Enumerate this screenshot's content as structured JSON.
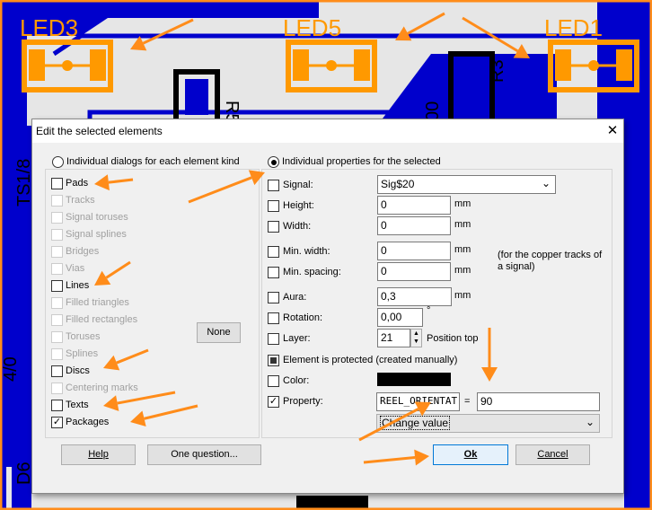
{
  "pcb": {
    "labels": [
      "LED3",
      "LED5",
      "LED1",
      "R5",
      "R3",
      "00",
      "TS1/8",
      "4/0",
      "D6"
    ]
  },
  "dialog": {
    "title": "Edit the selected elements",
    "close_label": "✕",
    "mode_left": "Individual dialogs for each element kind",
    "mode_right": "Individual properties for the selected",
    "mode_selected": "right",
    "element_kinds": [
      {
        "label": "Pads",
        "enabled": true,
        "checked": false
      },
      {
        "label": "Tracks",
        "enabled": false,
        "checked": false
      },
      {
        "label": "Signal toruses",
        "enabled": false,
        "checked": false
      },
      {
        "label": "Signal splines",
        "enabled": false,
        "checked": false
      },
      {
        "label": "Bridges",
        "enabled": false,
        "checked": false
      },
      {
        "label": "Vias",
        "enabled": false,
        "checked": false
      },
      {
        "label": "Lines",
        "enabled": true,
        "checked": false
      },
      {
        "label": "Filled triangles",
        "enabled": false,
        "checked": false
      },
      {
        "label": "Filled rectangles",
        "enabled": false,
        "checked": false
      },
      {
        "label": "Toruses",
        "enabled": false,
        "checked": false
      },
      {
        "label": "Splines",
        "enabled": false,
        "checked": false
      },
      {
        "label": "Discs",
        "enabled": true,
        "checked": false
      },
      {
        "label": "Centering marks",
        "enabled": false,
        "checked": false
      },
      {
        "label": "Texts",
        "enabled": true,
        "checked": false
      },
      {
        "label": "Packages",
        "enabled": true,
        "checked": true
      }
    ],
    "none_button": "None",
    "props": {
      "signal": {
        "label": "Signal:",
        "value": "Sig$20"
      },
      "height": {
        "label": "Height:",
        "value": "0",
        "unit": "mm"
      },
      "width": {
        "label": "Width:",
        "value": "0",
        "unit": "mm"
      },
      "min_width": {
        "label": "Min. width:",
        "value": "0",
        "unit": "mm"
      },
      "min_spacing": {
        "label": "Min. spacing:",
        "value": "0",
        "unit": "mm"
      },
      "copper_note": "(for the copper tracks of a signal)",
      "aura": {
        "label": "Aura:",
        "value": "0,3",
        "unit": "mm"
      },
      "rotation": {
        "label": "Rotation:",
        "value": "0,00",
        "unit": "°"
      },
      "layer": {
        "label": "Layer:",
        "value": "21",
        "note": "Position top"
      },
      "protected": {
        "label": "Element is protected (created manually)",
        "state": "indeterminate"
      },
      "color": {
        "label": "Color:",
        "value": "#000000"
      },
      "property": {
        "label": "Property:",
        "checked": true,
        "name": "REEL_ORIENTAT",
        "equals": "=",
        "value": "90",
        "action": "Change value"
      }
    },
    "buttons": {
      "help": "Help",
      "one_question": "One question...",
      "ok": "Ok",
      "cancel": "Cancel"
    }
  },
  "colors": {
    "pcb_blue": "#0000cc",
    "pcb_bg": "#e6e6e6",
    "highlight": "#ff9900",
    "annotation": "#ff8c1a"
  }
}
